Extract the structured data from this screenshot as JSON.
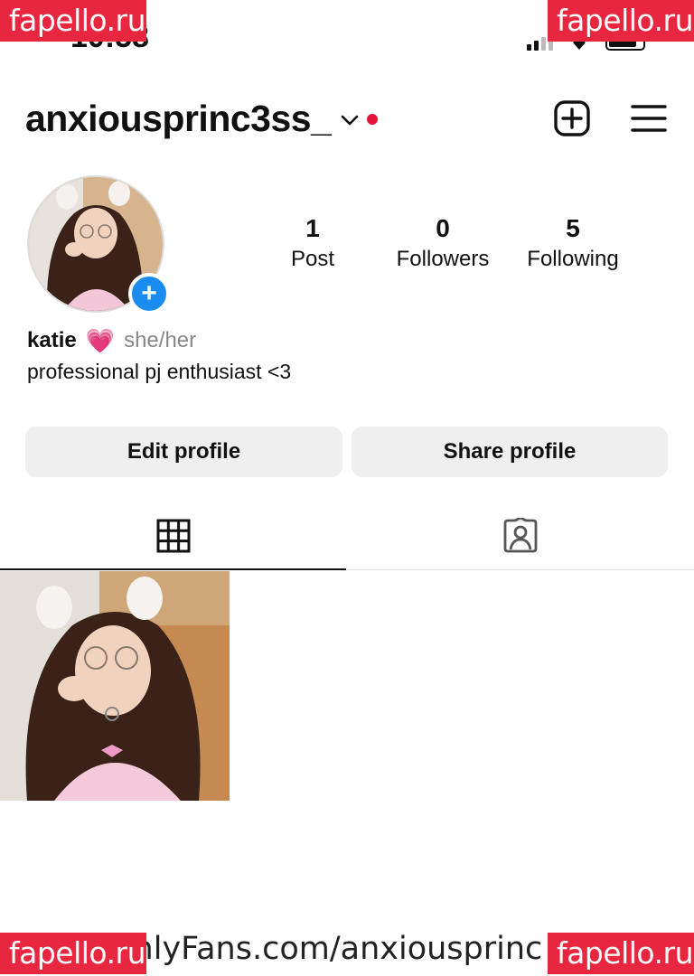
{
  "watermark": "fapello.ru",
  "status_bar": {
    "time": "10:58"
  },
  "header": {
    "username": "anxiousprinc3ss_"
  },
  "stats": [
    {
      "value": "1",
      "label": "Post"
    },
    {
      "value": "0",
      "label": "Followers"
    },
    {
      "value": "5",
      "label": "Following"
    }
  ],
  "bio": {
    "name": "katie",
    "emoji": "💗",
    "pronouns": "she/her",
    "text": "professional pj enthusiast <3"
  },
  "buttons": {
    "edit": "Edit profile",
    "share": "Share profile"
  },
  "icons": {
    "add_post": "plus-square-icon",
    "menu": "hamburger-menu-icon",
    "grid_tab": "grid-icon",
    "tagged_tab": "tagged-person-icon",
    "add_story": "plus-icon"
  },
  "bottom_text": "OnlyFans.com/anxiousprinc",
  "colors": {
    "watermark_bg": "#e8263f",
    "accent_blue": "#1a8cf0",
    "notification_dot": "#e5133a"
  }
}
